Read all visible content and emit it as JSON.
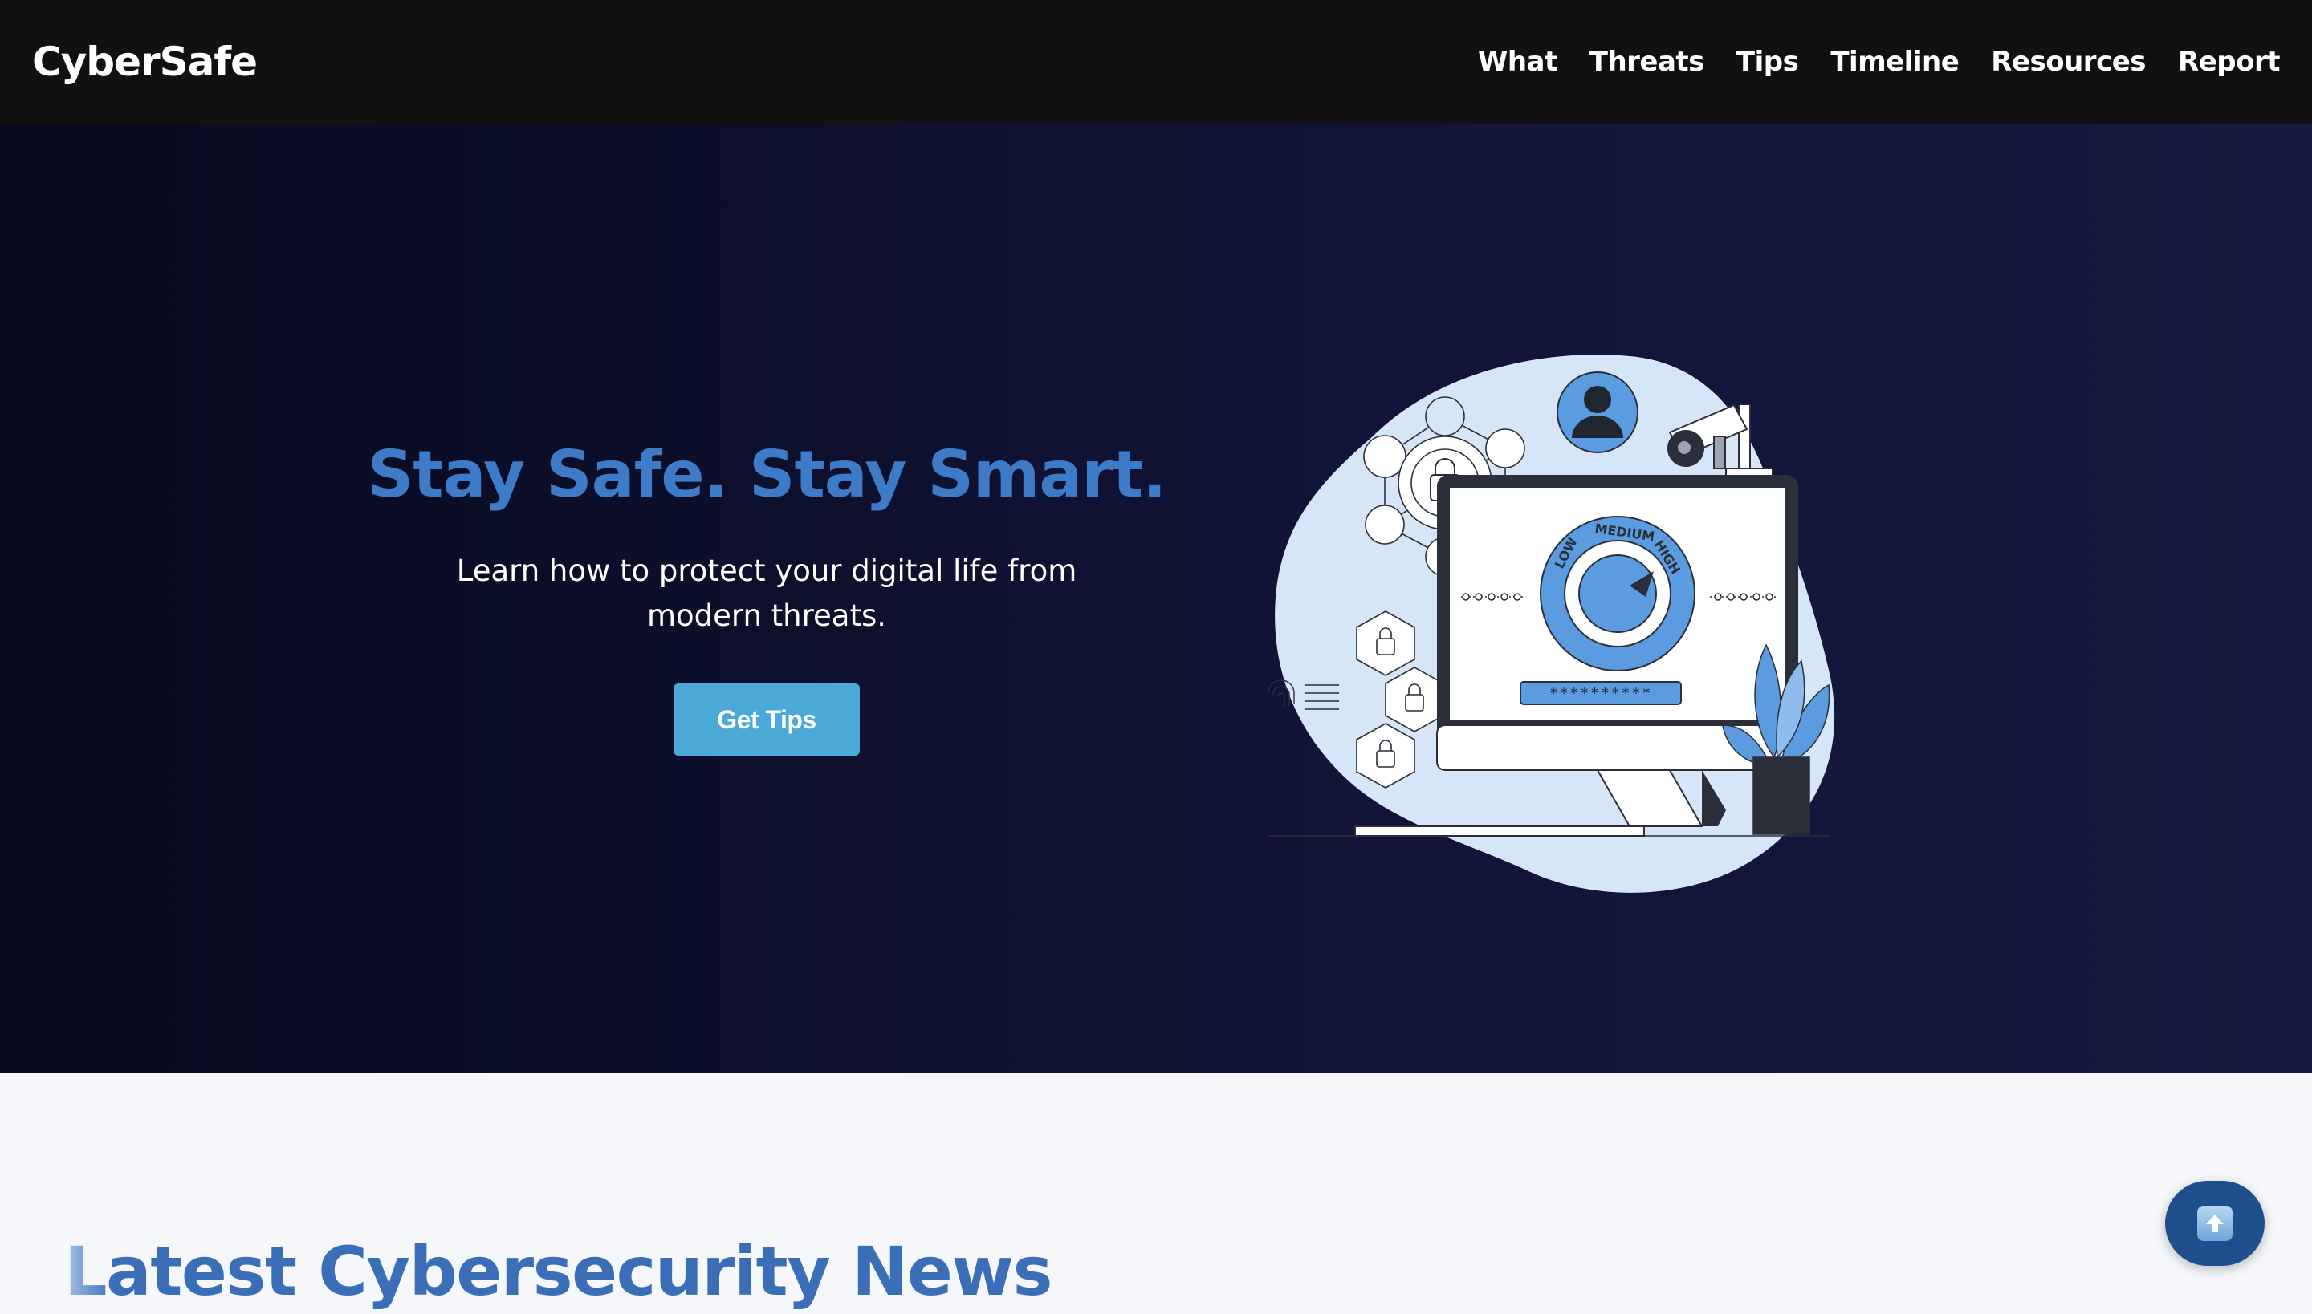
{
  "nav": {
    "logo": "CyberSafe",
    "links": [
      "What",
      "Threats",
      "Tips",
      "Timeline",
      "Resources",
      "Report"
    ]
  },
  "hero": {
    "title": "Stay Safe. Stay Smart.",
    "subtitle": "Learn how to protect your digital life from modern threats.",
    "button_label": "Get Tips",
    "illustration": {
      "gauge_labels": [
        "LOW",
        "MEDIUM",
        "HIGH"
      ],
      "password_mask": "**********",
      "icons": [
        "user-icon",
        "lock-icon",
        "fingerprint-icon",
        "security-camera-icon",
        "plant-icon"
      ]
    }
  },
  "news": {
    "title": "Latest Cybersecurity News"
  },
  "scroll_top": {
    "icon": "arrow-up-icon"
  },
  "colors": {
    "navbar": "#111111",
    "hero_bg": "#0d0f2c",
    "accent_blue": "#3d7bc8",
    "button": "#4aa9d6",
    "scroll_button": "#1e4e8c"
  }
}
